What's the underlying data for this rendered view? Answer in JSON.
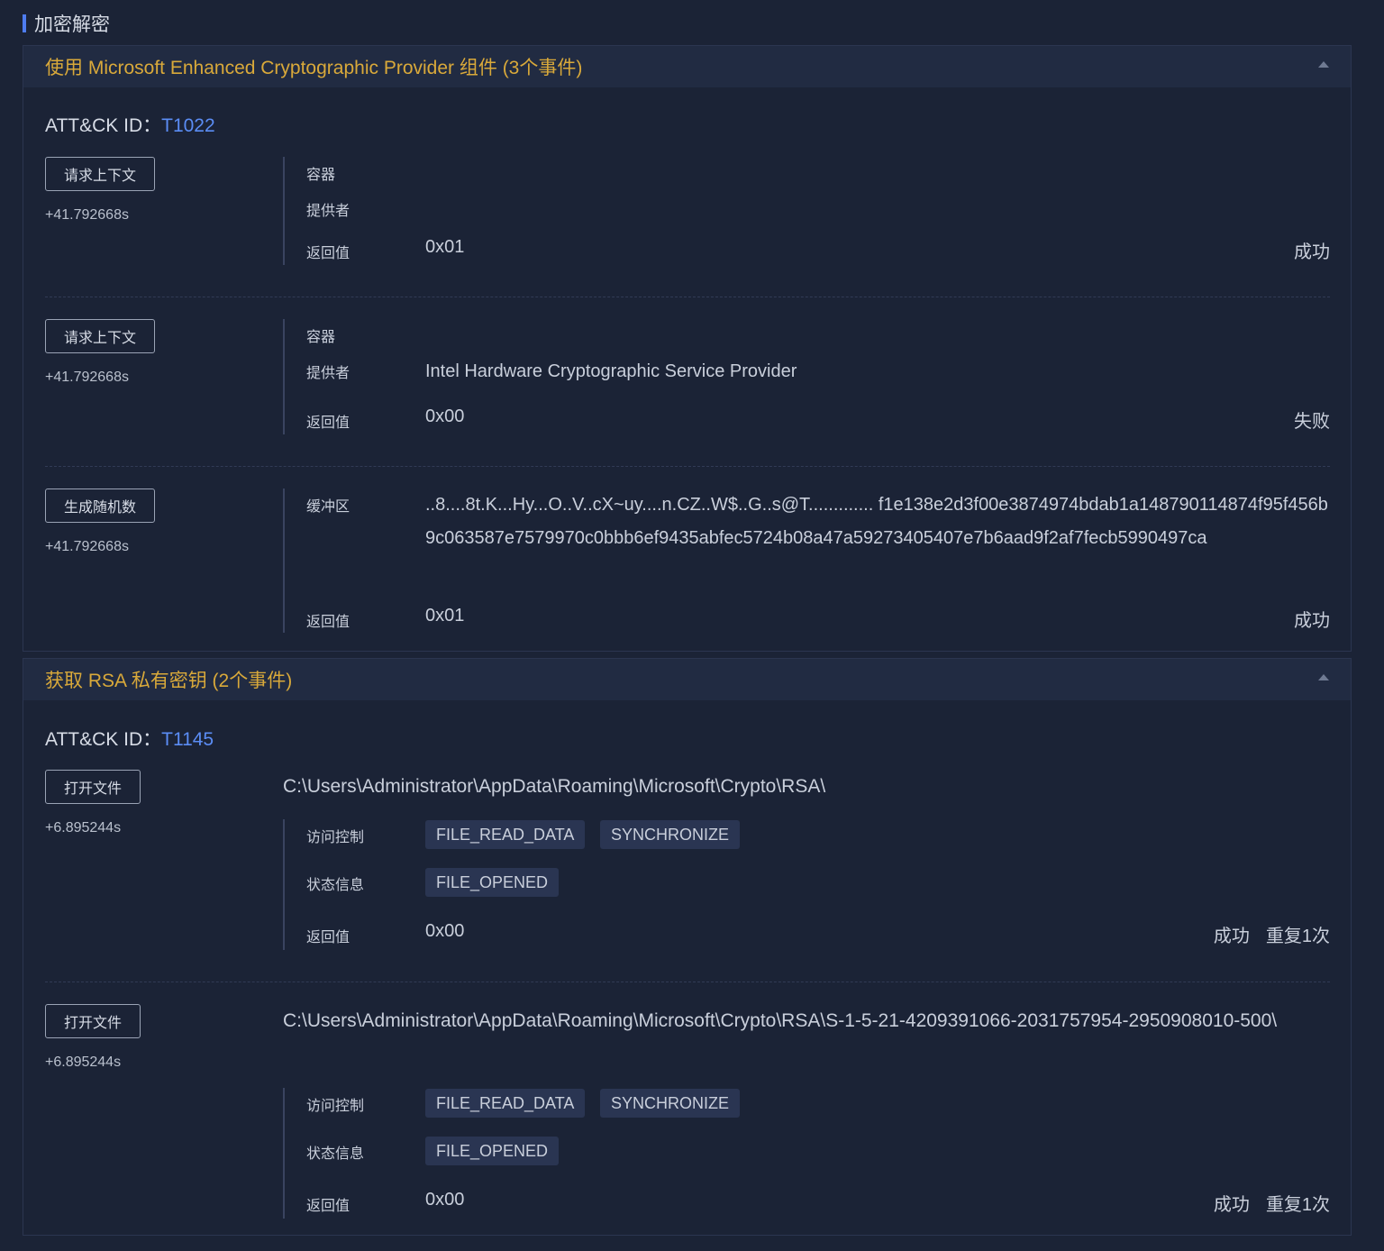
{
  "section": {
    "title": "加密解密"
  },
  "groups": [
    {
      "title": "使用 Microsoft Enhanced Cryptographic Provider 组件 (3个事件)",
      "attck_label": "ATT&CK ID：",
      "attck_id": "T1022",
      "events": [
        {
          "button": "请求上下文",
          "time": "+41.792668s",
          "fields": [
            {
              "label": "容器",
              "value": ""
            },
            {
              "label": "提供者",
              "value": ""
            },
            {
              "label": "返回值",
              "value": "0x01"
            }
          ],
          "status": "成功"
        },
        {
          "button": "请求上下文",
          "time": "+41.792668s",
          "fields": [
            {
              "label": "容器",
              "value": ""
            },
            {
              "label": "提供者",
              "value": "Intel Hardware Cryptographic Service Provider"
            },
            {
              "label": "返回值",
              "value": "0x00"
            }
          ],
          "status": "失败"
        },
        {
          "button": "生成随机数",
          "time": "+41.792668s",
          "fields": [
            {
              "label": "缓冲区",
              "value": "..8....8t.K...Hy...O..V..cX~uy....n.CZ..W$..G..s@T............. f1e138e2d3f00e3874974bdab1a148790114874f95f456b9c063587e7579970c0bbb6ef9435abfec5724b08a47a59273405407e7b6aad9f2af7fecb5990497ca"
            },
            {
              "label": "返回值",
              "value": "0x01"
            }
          ],
          "status": "成功"
        }
      ]
    },
    {
      "title": "获取 RSA 私有密钥 (2个事件)",
      "attck_label": "ATT&CK ID：",
      "attck_id": "T1145",
      "events": [
        {
          "button": "打开文件",
          "time": "+6.895244s",
          "path": "C:\\Users\\Administrator\\AppData\\Roaming\\Microsoft\\Crypto\\RSA\\",
          "access_label": "访问控制",
          "access_tags": [
            "FILE_READ_DATA",
            "SYNCHRONIZE"
          ],
          "state_label": "状态信息",
          "state_tags": [
            "FILE_OPENED"
          ],
          "return_label": "返回值",
          "return_value": "0x00",
          "status": "成功",
          "repeat": "重复1次"
        },
        {
          "button": "打开文件",
          "time": "+6.895244s",
          "path": "C:\\Users\\Administrator\\AppData\\Roaming\\Microsoft\\Crypto\\RSA\\S-1-5-21-4209391066-2031757954-2950908010-500\\",
          "access_label": "访问控制",
          "access_tags": [
            "FILE_READ_DATA",
            "SYNCHRONIZE"
          ],
          "state_label": "状态信息",
          "state_tags": [
            "FILE_OPENED"
          ],
          "return_label": "返回值",
          "return_value": "0x00",
          "status": "成功",
          "repeat": "重复1次"
        }
      ]
    }
  ],
  "colors": {
    "accent": "#4e7cf0",
    "group_title": "#d9a93a",
    "attck_id": "#5b8df5",
    "background": "#1b2336"
  }
}
